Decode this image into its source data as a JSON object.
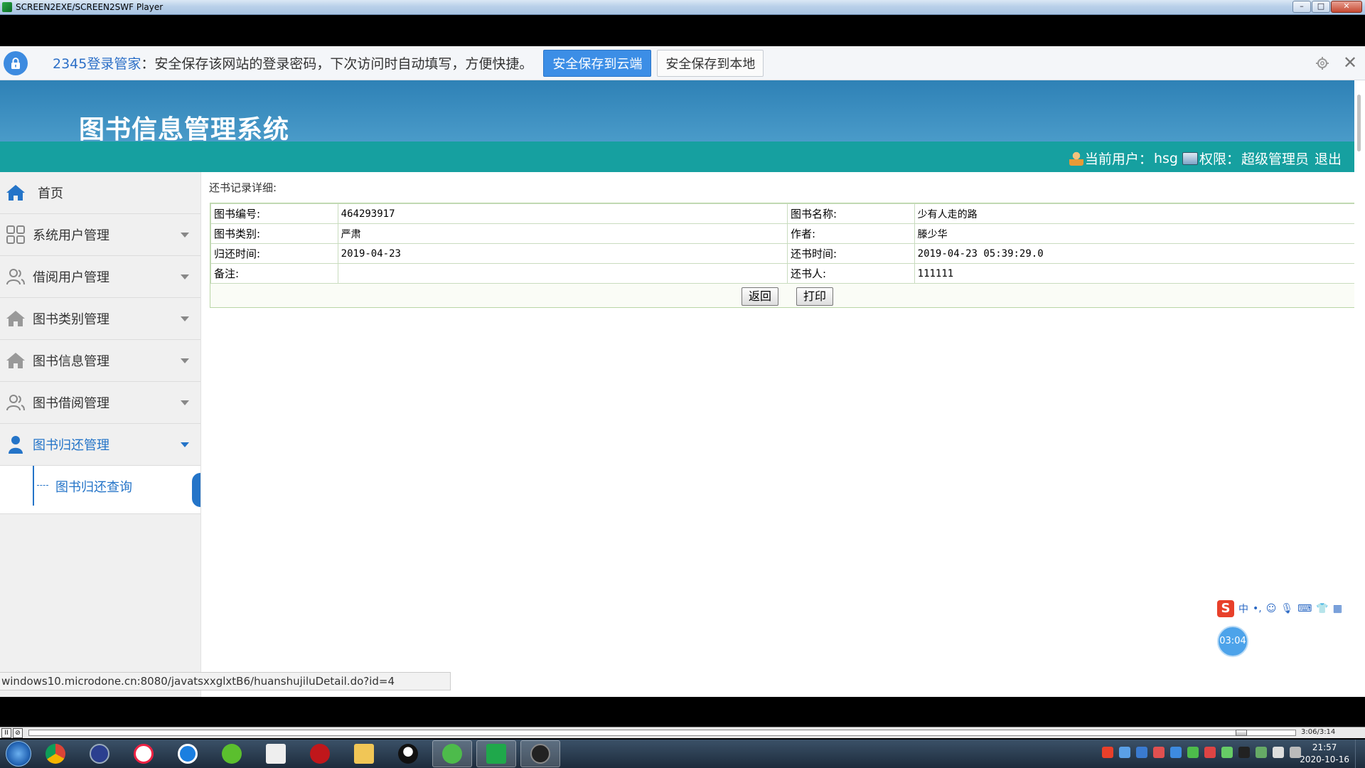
{
  "window": {
    "title": "SCREEN2EXE/SCREEN2SWF Player",
    "minimize": "–",
    "maximize": "□",
    "close": "✕"
  },
  "password_bar": {
    "brand": "2345登录管家",
    "message": "：安全保存该网站的登录密码，下次访问时自动填写，方便快捷。",
    "save_cloud": "安全保存到云端",
    "save_local": "安全保存到本地",
    "close_glyph": "✕"
  },
  "app": {
    "title": "图书信息管理系统",
    "user_label": "当前用户：",
    "user_name": "hsg",
    "perm_label": "权限：",
    "perm_value": "超级管理员",
    "logout": "退出"
  },
  "sidebar": {
    "items": [
      {
        "label": "首页"
      },
      {
        "label": "系统用户管理"
      },
      {
        "label": "借阅用户管理"
      },
      {
        "label": "图书类别管理"
      },
      {
        "label": "图书信息管理"
      },
      {
        "label": "图书借阅管理"
      },
      {
        "label": "图书归还管理"
      }
    ],
    "sub_item": "图书归还查询"
  },
  "detail": {
    "title": "还书记录详细:",
    "rows": [
      {
        "l1": "图书编号:",
        "v1": "464293917",
        "l2": "图书名称:",
        "v2": "少有人走的路"
      },
      {
        "l1": "图书类别:",
        "v1": "严肃",
        "l2": "作者:",
        "v2": "滕少华"
      },
      {
        "l1": "归还时间:",
        "v1": "2019-04-23",
        "l2": "还书时间:",
        "v2": "2019-04-23 05:39:29.0"
      },
      {
        "l1": "备注:",
        "v1": "",
        "l2": "还书人:",
        "v2": "111111"
      }
    ],
    "back_button": "返回",
    "print_button": "打印"
  },
  "status_url": "windows10.microdone.cn:8080/javatsxxglxtB6/huanshujiluDetail.do?id=4",
  "ime": {
    "logo": "S",
    "mode": "中",
    "punct": "•,"
  },
  "timer": "03:04",
  "player": {
    "play_pause": "II",
    "time": "3:06/3:14"
  },
  "taskbar": {
    "clock_time": "21:57",
    "clock_date": "2020-10-16"
  },
  "colors": {
    "header": "#2e81b6",
    "userbar": "#16a0a0",
    "accent": "#2474c8"
  }
}
